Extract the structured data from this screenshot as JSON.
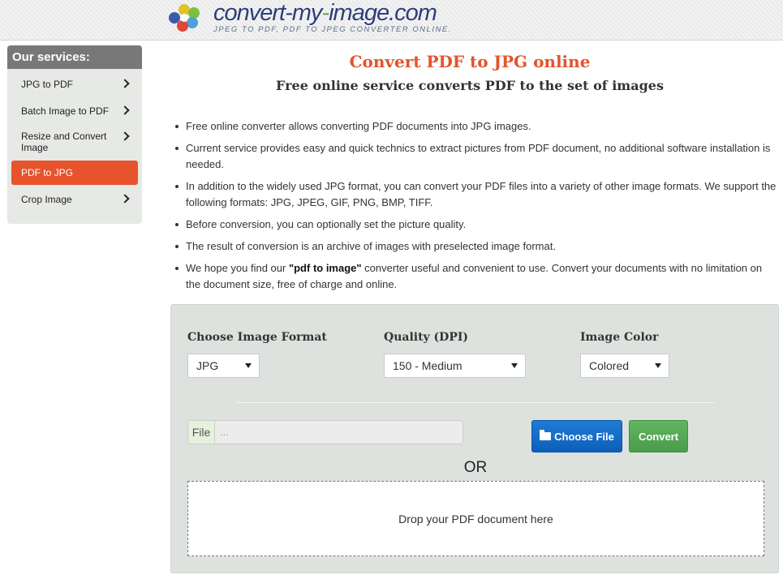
{
  "header": {
    "logo_title_a": "convert-my",
    "logo_title_dash": "-",
    "logo_title_b": "image.com",
    "logo_subtitle": "JPEG TO PDF, PDF TO JPEG CONVERTER ONLINE."
  },
  "sidebar": {
    "heading": "Our services:",
    "items": [
      {
        "label": "JPG to PDF"
      },
      {
        "label": "Batch Image to PDF"
      },
      {
        "label": "Resize and Convert Image"
      },
      {
        "label": "PDF to JPG",
        "active": true
      },
      {
        "label": "Crop Image"
      }
    ]
  },
  "main": {
    "title": "Convert PDF to JPG online",
    "subtitle": "Free online service converts PDF to the set of images",
    "bullets": [
      "Free online converter allows converting PDF documents into JPG images.",
      "Current service provides easy and quick technics to extract pictures from PDF document, no additional software installation is needed.",
      "In addition to the widely used JPG format, you can convert your PDF files into a variety of other image formats. We support the following formats: JPG, JPEG, GIF, PNG, BMP, TIFF.",
      "Before conversion, you can optionally set the picture quality.",
      "The result of conversion is an archive of images with preselected image format."
    ],
    "bullet_last_pre": "We hope you find our ",
    "bullet_last_bold": "\"pdf to image\"",
    "bullet_last_post": " converter useful and convenient to use. Convert your documents with no limitation on the document size, free of charge and online."
  },
  "converter": {
    "format_label": "Choose Image Format",
    "format_value": "JPG",
    "quality_label": "Quality (DPI)",
    "quality_value": "150 - Medium",
    "color_label": "Image Color",
    "color_value": "Colored",
    "file_tag": "File",
    "file_placeholder": "...",
    "choose_button": "Choose File",
    "convert_button": "Convert",
    "or_text": "OR",
    "dropzone_text": "Drop your PDF document here"
  },
  "colors": {
    "accent": "#e7532d",
    "primary_button": "#0d60b8",
    "success_button": "#4a9c4a"
  }
}
